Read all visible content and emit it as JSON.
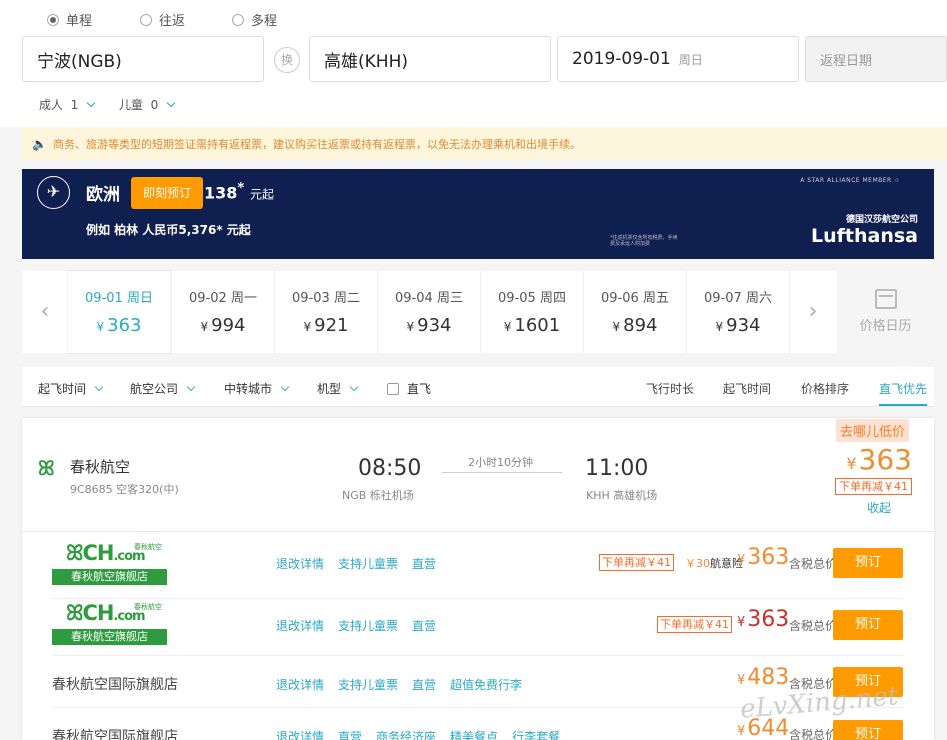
{
  "trip": {
    "one_way": "单程",
    "round_trip": "往返",
    "multi": "多程",
    "from": "宁波(NGB)",
    "swap": "换",
    "to": "高雄(KHH)",
    "date": "2019-09-01",
    "weekday": "周日",
    "return_placeholder": "返程日期",
    "adult_label": "成人",
    "adult_count": "1",
    "child_label": "儿童",
    "child_count": "0"
  },
  "notice": "商务、旅游等类型的短期签证需持有返程票，建议购买往返票或持有返程票，以免无法办理乘机和出境手续。",
  "banner": {
    "region": "欧洲",
    "book": "即刻预订",
    "price_tail": "138",
    "price_mark": "*",
    "price_unit": "元起",
    "example": "例如 柏林 人民币5,376* 元起",
    "alliance": "A STAR ALLIANCE MEMBER ☆",
    "airline_cn": "德国汉莎航空公司",
    "airline_en": "Lufthansa",
    "fine_print": "*往返机票仅含所有税费，手续费及承运人附加费"
  },
  "dates": [
    {
      "date": "09-01 周日",
      "price": "363"
    },
    {
      "date": "09-02 周一",
      "price": "994"
    },
    {
      "date": "09-03 周二",
      "price": "921"
    },
    {
      "date": "09-04 周三",
      "price": "934"
    },
    {
      "date": "09-05 周四",
      "price": "1601"
    },
    {
      "date": "09-06 周五",
      "price": "894"
    },
    {
      "date": "09-07 周六",
      "price": "934"
    }
  ],
  "yen": "¥",
  "calendar": "价格日历",
  "filters": [
    "起飞时间",
    "航空公司",
    "中转城市",
    "机型"
  ],
  "direct_only": "直飞",
  "sorts": [
    "飞行时长",
    "起飞时间",
    "价格排序",
    "直飞优先"
  ],
  "flight": {
    "airline": "春秋航空",
    "number": "9C8685 空客320(中)",
    "dep_time": "08:50",
    "dep_airport": "NGB 栎社机场",
    "duration": "2小时10分钟",
    "arr_time": "11:00",
    "arr_airport": "KHH 高雄机场",
    "low_tag": "去哪儿低价",
    "price": "363",
    "discount": "下单再减￥41",
    "collapse": "收起"
  },
  "offers": [
    {
      "shop": "春秋航空旗舰店",
      "logo": "CH",
      "logo_sub": ".com",
      "logo_cn": "春秋航空",
      "links": [
        "退改详情",
        "支持儿童票",
        "直营"
      ],
      "discount": "下单再减￥41",
      "extra_amount": "￥30",
      "extra_label": "航意险",
      "price": "363",
      "tax": "含税总价",
      "book": "预订"
    },
    {
      "shop": "春秋航空旗舰店",
      "logo": "CH",
      "logo_sub": ".com",
      "logo_cn": "春秋航空",
      "links": [
        "退改详情",
        "支持儿童票",
        "直营"
      ],
      "discount": "下单再减￥41",
      "price": "363",
      "tax": "含税总价",
      "book": "预订"
    },
    {
      "shop": "春秋航空国际旗舰店",
      "links": [
        "退改详情",
        "支持儿童票",
        "直营",
        "超值免费行李"
      ],
      "price": "483",
      "tax": "含税总价",
      "book": "预订"
    },
    {
      "shop": "春秋航空国际旗舰店",
      "links": [
        "退改详情",
        "直营",
        "商务经济座",
        "精美餐点",
        "行李套餐"
      ],
      "price": "644",
      "tax": "含税总价",
      "book": "预订"
    }
  ],
  "watermark": "eLvXing.net",
  "colors": {
    "accent": "#2aa9c4",
    "orange": "#ff9b00",
    "price": "#f08c2e",
    "red_price": "#c9302c",
    "green": "#2e9b3e",
    "banner_bg": "#0f1f4f"
  }
}
